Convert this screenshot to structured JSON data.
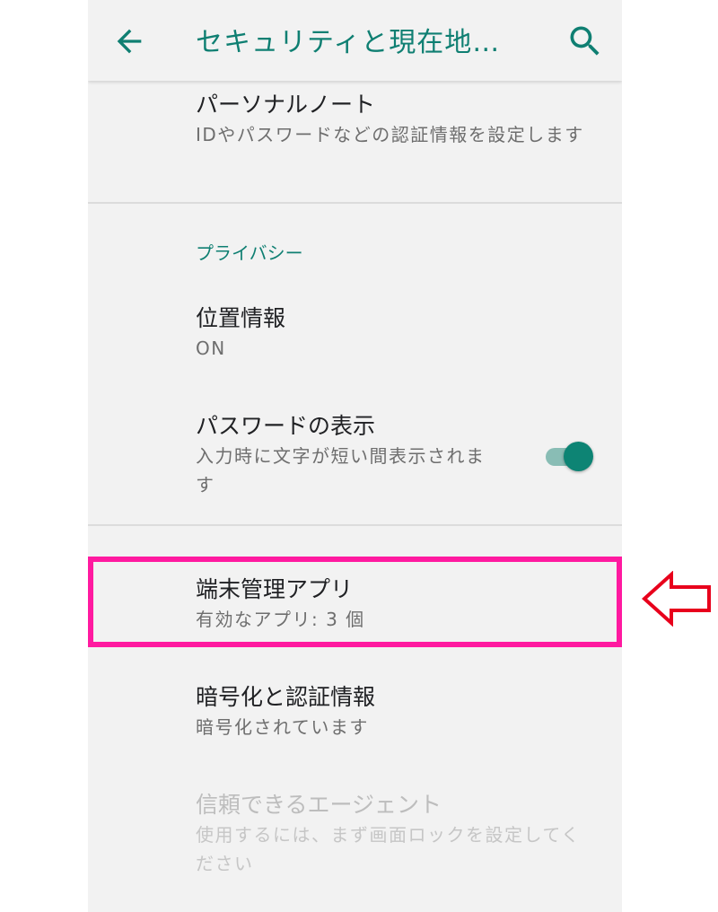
{
  "appbar": {
    "title": "セキュリティと現在地…",
    "back_icon": "arrow-back-icon",
    "search_icon": "search-icon"
  },
  "items": {
    "personal_note": {
      "title": "パーソナルノート",
      "summary": "IDやパスワードなどの認証情報を設定します"
    },
    "privacy_header": "プライバシー",
    "location": {
      "title": "位置情報",
      "summary": "ON"
    },
    "show_password": {
      "title": "パスワードの表示",
      "summary": "入力時に文字が短い間表示されます",
      "toggle_on": true
    },
    "device_admin": {
      "title": "端末管理アプリ",
      "summary": "有効なアプリ: 3 個"
    },
    "encryption": {
      "title": "暗号化と認証情報",
      "summary": "暗号化されています"
    },
    "trust_agents": {
      "title": "信頼できるエージェント",
      "summary": "使用するには、まず画面ロックを設定してください",
      "enabled": false
    }
  },
  "colors": {
    "accent": "#0f7f72",
    "highlight": "#ff1aa0",
    "arrow": "#e8001c"
  }
}
